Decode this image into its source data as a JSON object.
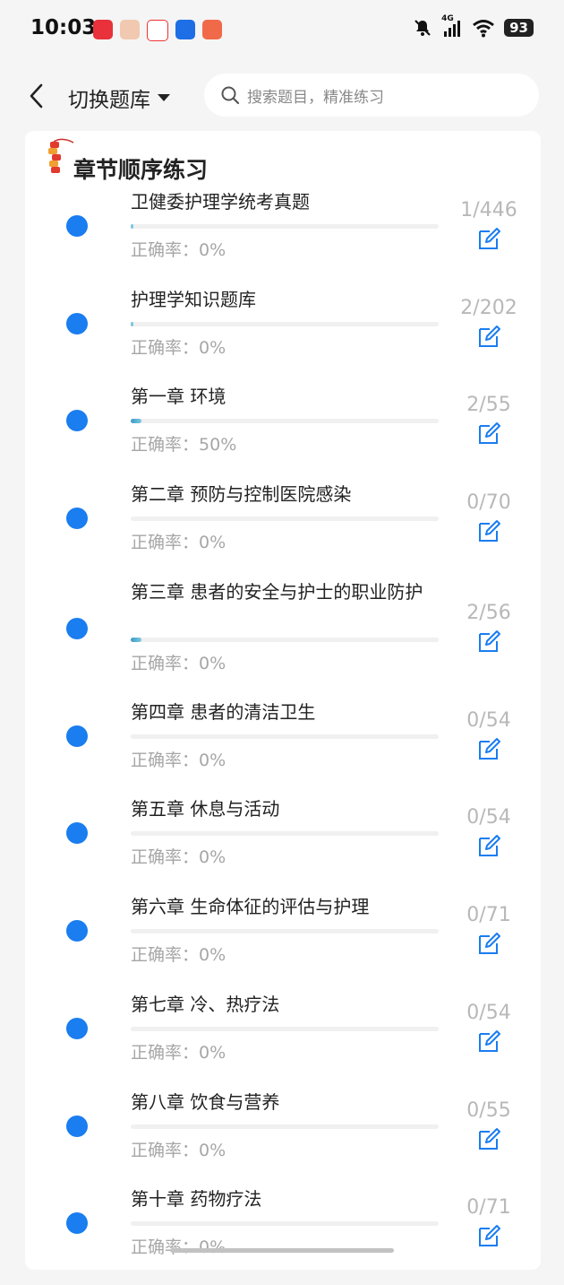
{
  "status_bar": {
    "time": "10:03",
    "network": "4G",
    "battery": "93",
    "icons": [
      "mute-bell-icon",
      "signal-icon",
      "wifi-icon",
      "battery-icon"
    ]
  },
  "header": {
    "back_icon": "chevron-left-icon",
    "bank_label": "切换题库",
    "search_placeholder": "搜索题目，精准练习"
  },
  "section": {
    "title": "章节顺序练习",
    "icon": "firecracker-icon"
  },
  "accuracy_label": "正确率：",
  "rows": [
    {
      "title": "卫健委护理学统考真题",
      "progress": "1/446",
      "accuracy": "0%",
      "fill": 0.002
    },
    {
      "title": "护理学知识题库",
      "progress": "2/202",
      "accuracy": "0%",
      "fill": 0.01
    },
    {
      "title": "第一章 环境",
      "progress": "2/55",
      "accuracy": "50%",
      "fill": 0.036
    },
    {
      "title": "第二章 预防与控制医院感染",
      "progress": "0/70",
      "accuracy": "0%",
      "fill": 0
    },
    {
      "title": "第三章 患者的安全与护士的职业防护",
      "progress": "2/56",
      "accuracy": "0%",
      "fill": 0.036
    },
    {
      "title": "第四章 患者的清洁卫生",
      "progress": "0/54",
      "accuracy": "0%",
      "fill": 0
    },
    {
      "title": "第五章 休息与活动",
      "progress": "0/54",
      "accuracy": "0%",
      "fill": 0
    },
    {
      "title": "第六章 生命体征的评估与护理",
      "progress": "0/71",
      "accuracy": "0%",
      "fill": 0
    },
    {
      "title": "第七章 冷、热疗法",
      "progress": "0/54",
      "accuracy": "0%",
      "fill": 0
    },
    {
      "title": "第八章 饮食与营养",
      "progress": "0/55",
      "accuracy": "0%",
      "fill": 0
    },
    {
      "title": "第十章 药物疗法",
      "progress": "0/71",
      "accuracy": "0%",
      "fill": 0
    }
  ],
  "colors": {
    "accent": "#1a7df0",
    "progress_fill": "#7ec8e0",
    "muted_text": "#a6a6a6"
  }
}
